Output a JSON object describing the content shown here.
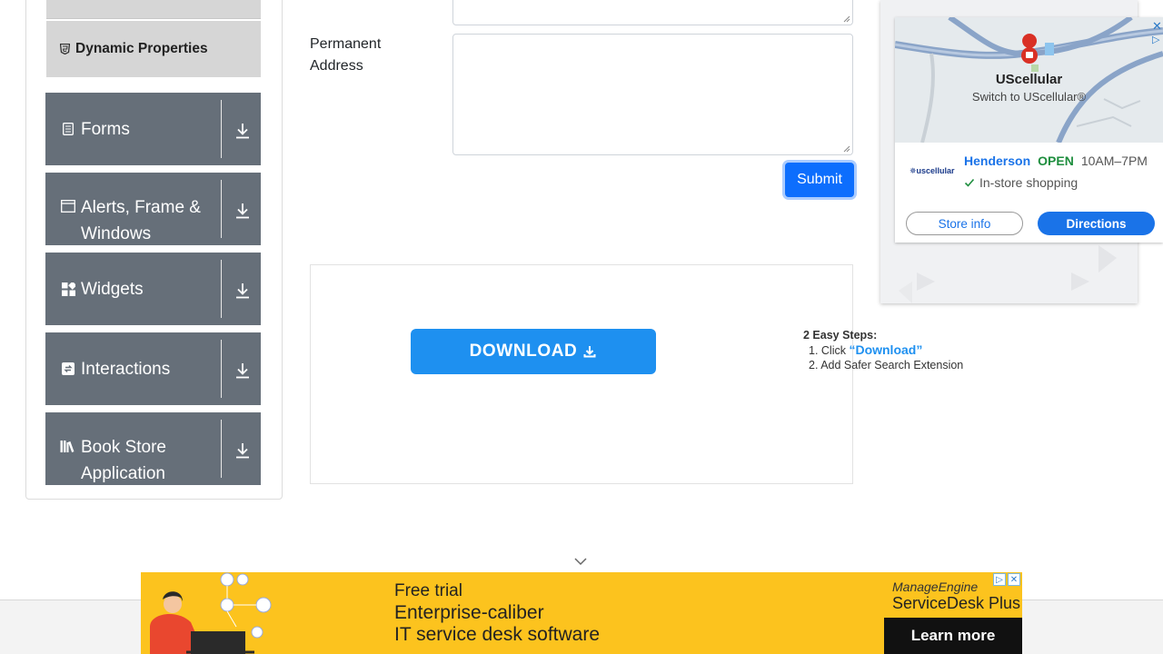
{
  "sidebar": {
    "sub_item": "Dynamic Properties",
    "groups": [
      {
        "label": "Forms",
        "icon": "document-icon"
      },
      {
        "label": "Alerts, Frame & Windows",
        "icon": "window-icon"
      },
      {
        "label": "Widgets",
        "icon": "widgets-icon"
      },
      {
        "label": "Interactions",
        "icon": "interactions-icon"
      },
      {
        "label": "Book Store Application",
        "icon": "books-icon"
      }
    ]
  },
  "form": {
    "permanent_address_label": "Permanent Address",
    "permanent_address_value": "",
    "submit_label": "Submit"
  },
  "ad_download": {
    "button_label": "DOWNLOAD",
    "steps_title": "2 Easy Steps:",
    "step1_prefix": "1. Click ",
    "step1_highlight": "“Download”",
    "step2": "2. Add Safer Search Extension"
  },
  "map_ad": {
    "brand": "UScellular",
    "tagline": "Switch to UScellular®",
    "logo_text": "✵uscellular",
    "location": "Henderson",
    "status": "OPEN",
    "hours": "10AM–7PM",
    "feature": "In-store shopping",
    "store_info_label": "Store info",
    "directions_label": "Directions",
    "accent": "#1a73e8",
    "open_color": "#1e8e3e"
  },
  "banner": {
    "line1": "Free trial",
    "line2": "Enterprise-caliber",
    "line3": "IT service desk software",
    "brand_top": "ManageEngine",
    "brand_name": "ServiceDesk Plus",
    "cta": "Learn more",
    "bg_color": "#fcc31e"
  }
}
